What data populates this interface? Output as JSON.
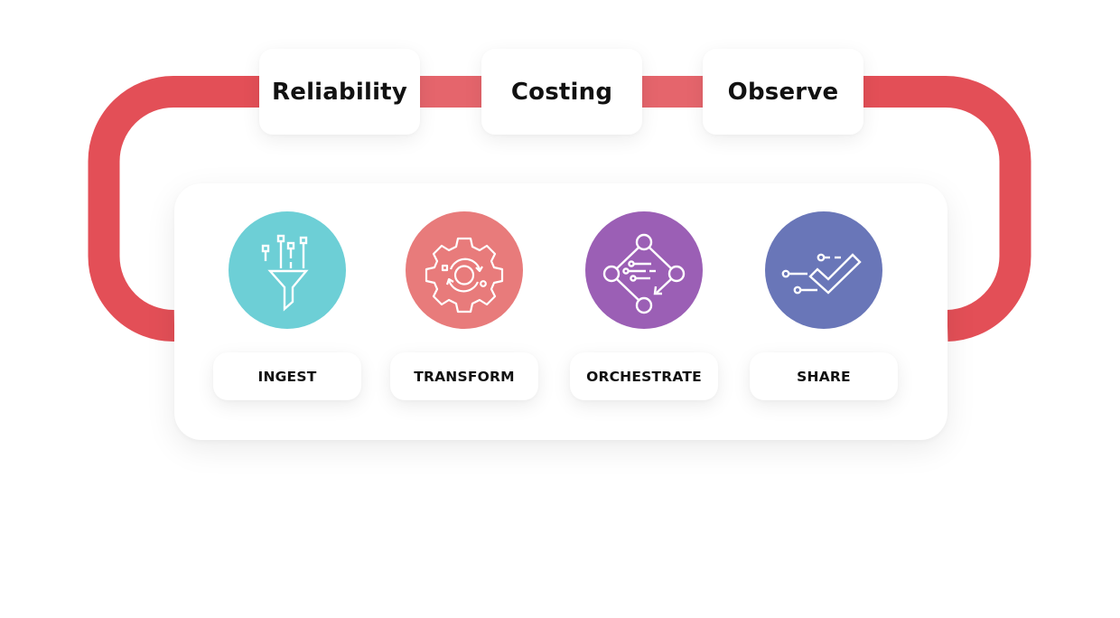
{
  "colors": {
    "loop": "#E34F57",
    "loop_mid": "#E5656C",
    "ingest": "#6DCFD6",
    "transform": "#E87B7B",
    "orchestrate": "#9B5FB5",
    "share": "#6976B8",
    "text": "#111111",
    "card": "#FFFFFF"
  },
  "top_pills": [
    {
      "label": "Reliability"
    },
    {
      "label": "Costing"
    },
    {
      "label": "Observe"
    }
  ],
  "stages": [
    {
      "label": "INGEST",
      "icon": "funnel-icon"
    },
    {
      "label": "TRANSFORM",
      "icon": "gear-cycle-icon"
    },
    {
      "label": "ORCHESTRATE",
      "icon": "node-diamond-icon"
    },
    {
      "label": "SHARE",
      "icon": "checkmark-circuit-icon"
    }
  ]
}
